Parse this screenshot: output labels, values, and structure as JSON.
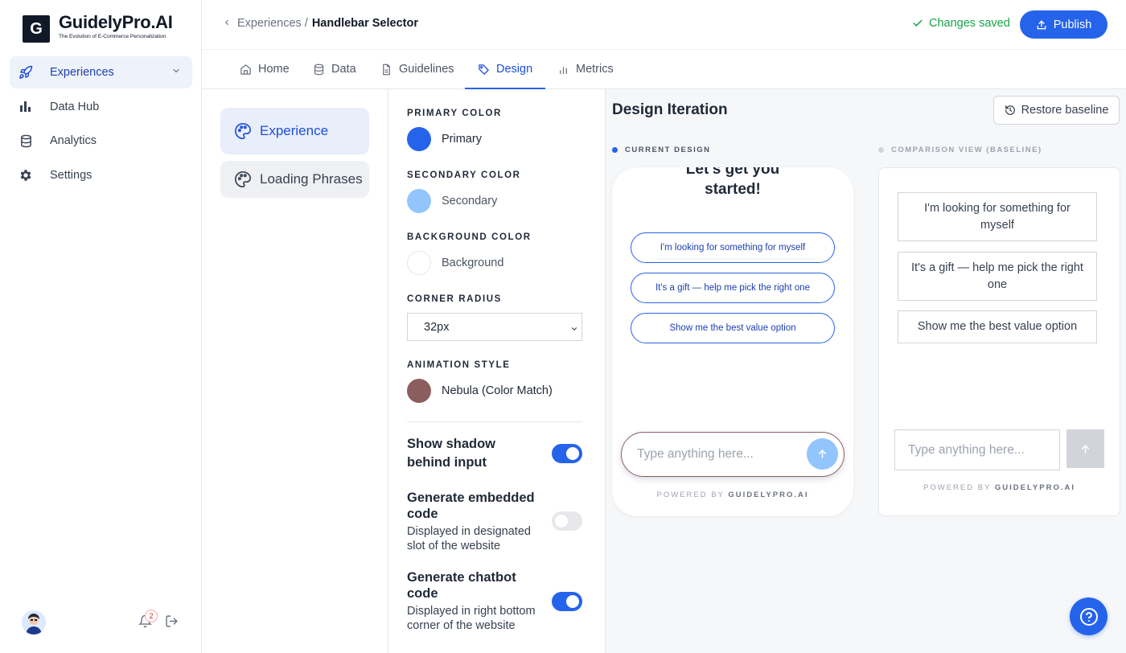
{
  "brand": {
    "mark": "G",
    "name": "GuidelyPro.AI",
    "tagline": "The Evolution of E-Commerce Personalization"
  },
  "sidebar": {
    "items": [
      {
        "label": "Experiences",
        "icon": "rocket-icon",
        "active": true
      },
      {
        "label": "Data Hub",
        "icon": "bar-chart-icon",
        "active": false
      },
      {
        "label": "Analytics",
        "icon": "database-icon",
        "active": false
      },
      {
        "label": "Settings",
        "icon": "gear-icon",
        "active": false
      }
    ],
    "notification_count": "2"
  },
  "header": {
    "breadcrumb_parent": "Experiences",
    "breadcrumb_sep": "/",
    "breadcrumb_current": "Handlebar Selector",
    "status": "Changes saved",
    "publish_label": "Publish"
  },
  "tabs": [
    {
      "label": "Home",
      "icon": "home-icon"
    },
    {
      "label": "Data",
      "icon": "database-icon"
    },
    {
      "label": "Guidelines",
      "icon": "document-icon"
    },
    {
      "label": "Design",
      "icon": "tag-icon",
      "active": true
    },
    {
      "label": "Metrics",
      "icon": "bar-chart-icon"
    }
  ],
  "subnav": [
    {
      "label": "Experience",
      "icon": "palette-icon",
      "active": true
    },
    {
      "label": "Loading Phrases",
      "icon": "palette-icon"
    }
  ],
  "settings": {
    "primary": {
      "section": "PRIMARY COLOR",
      "label": "Primary",
      "color": "#2563eb"
    },
    "secondary": {
      "section": "SECONDARY COLOR",
      "label": "Secondary",
      "color": "#93c5fd"
    },
    "background": {
      "section": "BACKGROUND COLOR",
      "label": "Background",
      "color": "#ffffff"
    },
    "corner_radius": {
      "section": "CORNER RADIUS",
      "value": "32px"
    },
    "animation": {
      "section": "ANIMATION STYLE",
      "label": "Nebula (Color Match)",
      "color": "#8b5e5e"
    },
    "toggles": [
      {
        "title": "Show shadow behind input",
        "desc": "",
        "on": true
      },
      {
        "title": "Generate embedded code",
        "desc": "Displayed in designated slot of the website",
        "on": false
      },
      {
        "title": "Generate chatbot code",
        "desc": "Displayed in right bottom corner of the website",
        "on": true
      }
    ]
  },
  "preview": {
    "title": "Design Iteration",
    "restore_label": "Restore baseline",
    "current_label": "CURRENT DESIGN",
    "baseline_label": "COMPARISON VIEW (BASELINE)",
    "current": {
      "heading_cut": "Let's get you",
      "heading": "started!",
      "options": [
        "I'm looking for something for myself",
        "It's a gift — help me pick the right one",
        "Show me the best value option"
      ],
      "input_placeholder": "Type anything here...",
      "powered_prefix": "POWERED BY",
      "powered_brand": "GUIDELYPRO.AI"
    },
    "baseline": {
      "options": [
        "I'm looking for something for myself",
        "It's a gift — help me pick the right one",
        "Show me the best value option"
      ],
      "input_placeholder": "Type anything here...",
      "powered_prefix": "POWERED BY",
      "powered_brand": "GUIDELYPRO.AI"
    }
  },
  "colors": {
    "accent": "#2563eb",
    "success": "#16a34a",
    "active_bg": "#eef2fb"
  }
}
